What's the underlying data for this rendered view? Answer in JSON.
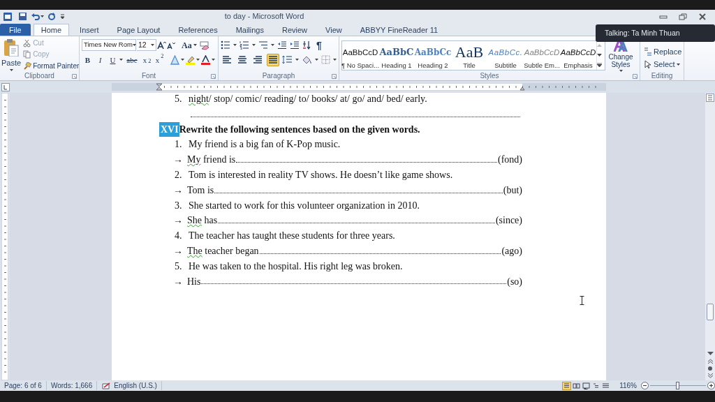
{
  "window": {
    "title": "to day - Microsoft Word"
  },
  "tabs": [
    {
      "label": "File",
      "kind": "file",
      "selected": false
    },
    {
      "label": "Home",
      "kind": "tab",
      "selected": true
    },
    {
      "label": "Insert",
      "kind": "tab",
      "selected": false
    },
    {
      "label": "Page Layout",
      "kind": "tab",
      "selected": false
    },
    {
      "label": "References",
      "kind": "tab",
      "selected": false
    },
    {
      "label": "Mailings",
      "kind": "tab",
      "selected": false
    },
    {
      "label": "Review",
      "kind": "tab",
      "selected": false
    },
    {
      "label": "View",
      "kind": "tab",
      "selected": false
    },
    {
      "label": "ABBYY FineReader 11",
      "kind": "tab",
      "selected": false
    }
  ],
  "clipboard": {
    "title": "Clipboard",
    "paste": "Paste",
    "items": [
      {
        "label": "Cut",
        "kind": "cut",
        "disabled": true
      },
      {
        "label": "Copy",
        "kind": "copy",
        "disabled": true
      },
      {
        "label": "Format Painter",
        "kind": "painter",
        "disabled": false
      }
    ]
  },
  "font": {
    "title": "Font",
    "name": "Times New Rom",
    "size": "12",
    "case_button": "Aa",
    "format_buttons": [
      {
        "label": "B",
        "kind": "bold"
      },
      {
        "label": "I",
        "kind": "italic"
      },
      {
        "label": "U",
        "kind": "underline"
      },
      {
        "label": "abc",
        "kind": "strike"
      },
      {
        "label": "x$_{2}$",
        "kind": "script"
      },
      {
        "label": "x$^{2}$",
        "kind": "script"
      }
    ]
  },
  "paragraph": {
    "title": "Paragraph",
    "marks_button": "¶",
    "alignments": [
      {
        "kind": "left",
        "selected": false
      },
      {
        "kind": "center",
        "selected": false
      },
      {
        "kind": "right",
        "selected": false
      },
      {
        "kind": "justify",
        "selected": true
      }
    ]
  },
  "styles": {
    "title": "Styles",
    "change_styles": "Change Styles",
    "items": [
      {
        "preview": "AaBbCcD",
        "label": "¶ No Spaci...",
        "kind": "normal"
      },
      {
        "preview": "AaBbC",
        "label": "Heading 1",
        "kind": "heading1"
      },
      {
        "preview": "AaBbCc",
        "label": "Heading 2",
        "kind": "heading2"
      },
      {
        "preview": "AaB",
        "label": "Title",
        "kind": "title"
      },
      {
        "preview": "AaBbCc.",
        "label": "Subtitle",
        "kind": "subtitle"
      },
      {
        "preview": "AaBbCcD",
        "label": "Subtle Em...",
        "kind": "subtle"
      },
      {
        "preview": "AaBbCcD",
        "label": "Emphasis",
        "kind": "emphasis"
      }
    ]
  },
  "editing": {
    "title": "Editing",
    "items": [
      {
        "label": "Replace",
        "kind": "replace"
      },
      {
        "label": "Select",
        "kind": "select"
      }
    ]
  },
  "notification": {
    "text": "Talking: Ta Minh Thuan"
  },
  "document": {
    "lines": [
      {
        "kind": "numbered",
        "number": "5.",
        "flagged": "night",
        "text": "/ stop/ comic/ reading/ to/ books/ at/ go/ and/ bed/ early."
      },
      {
        "kind": "leader"
      },
      {
        "kind": "heading",
        "marker": "XVI",
        "text": "Rewrite the following sentences based on the given words."
      },
      {
        "kind": "numbered",
        "number": "1.",
        "text": "My friend is a big fan of K-Pop music."
      },
      {
        "kind": "answer",
        "arrow": "→",
        "flagged": "My",
        "text": " friend is",
        "hint": "(fond)"
      },
      {
        "kind": "numbered",
        "number": "2.",
        "text": "Tom is interested in reality TV shows. He doesn’t like game shows."
      },
      {
        "kind": "answer",
        "arrow": "→",
        "text": "Tom is",
        "hint": "(but)"
      },
      {
        "kind": "numbered",
        "number": "3.",
        "text": "She started to work for this volunteer organization in 2010."
      },
      {
        "kind": "answer",
        "arrow": "→",
        "flagged": "She",
        "text": " has",
        "hint": "(since)"
      },
      {
        "kind": "numbered",
        "number": "4.",
        "text": "The teacher has taught these students for three years."
      },
      {
        "kind": "answer",
        "arrow": "→",
        "flagged": "The",
        "text": " teacher began",
        "hint": "(ago)"
      },
      {
        "kind": "numbered",
        "number": "5.",
        "text": "He was taken to the hospital. His right leg was broken."
      },
      {
        "kind": "answer",
        "arrow": "→",
        "text": "His",
        "hint": "(so)"
      }
    ]
  },
  "status_bar": {
    "items": [
      {
        "label": "Page: 6 of 6",
        "kind": "text"
      },
      {
        "label": "Words: 1,666",
        "kind": "text"
      },
      {
        "label": "English (U.S.)",
        "kind": "language"
      }
    ],
    "views": [
      {
        "selected": true
      },
      {
        "selected": false
      },
      {
        "selected": false
      },
      {
        "selected": false
      },
      {
        "selected": false
      }
    ],
    "zoom": "116%",
    "level": 0.49
  }
}
